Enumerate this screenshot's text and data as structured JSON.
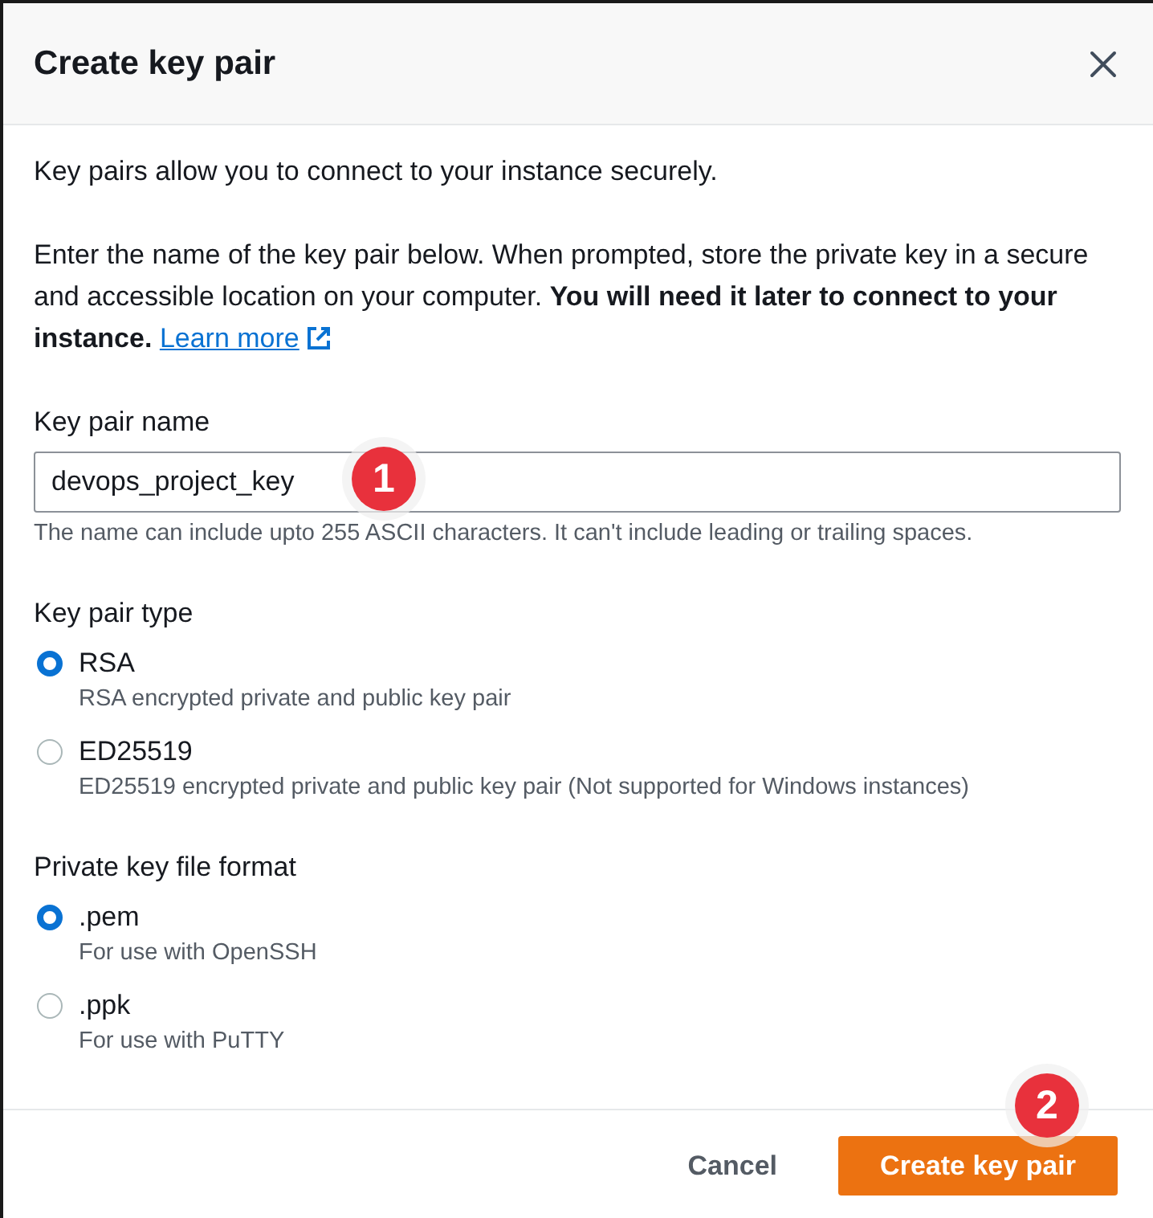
{
  "dialog": {
    "title": "Create key pair"
  },
  "intro": "Key pairs allow you to connect to your instance securely.",
  "instructions": {
    "text": "Enter the name of the key pair below. When prompted, store the private key in a secure and accessible location on your computer. **You will need it later to connect to your instance.**",
    "link": "Learn more"
  },
  "name_field": {
    "label": "Key pair name",
    "value": "devops_project_key",
    "hint": "The name can include upto 255 ASCII characters. It can't include leading or trailing spaces."
  },
  "key_type": {
    "label": "Key pair type",
    "options": [
      {
        "label": "RSA",
        "description": "RSA encrypted private and public key pair",
        "selected": true
      },
      {
        "label": "ED25519",
        "description": "ED25519 encrypted private and public key pair (Not supported for Windows instances)",
        "selected": false
      }
    ]
  },
  "file_format": {
    "label": "Private key file format",
    "options": [
      {
        "label": ".pem",
        "description": "For use with OpenSSH",
        "selected": true
      },
      {
        "label": ".ppk",
        "description": "For use with PuTTY",
        "selected": false
      }
    ]
  },
  "buttons": [
    {
      "label": "Cancel",
      "kind": "link"
    },
    {
      "label": "Create key pair",
      "kind": "primary"
    }
  ],
  "markers": [
    {
      "label": "1"
    },
    {
      "label": "2"
    }
  ]
}
